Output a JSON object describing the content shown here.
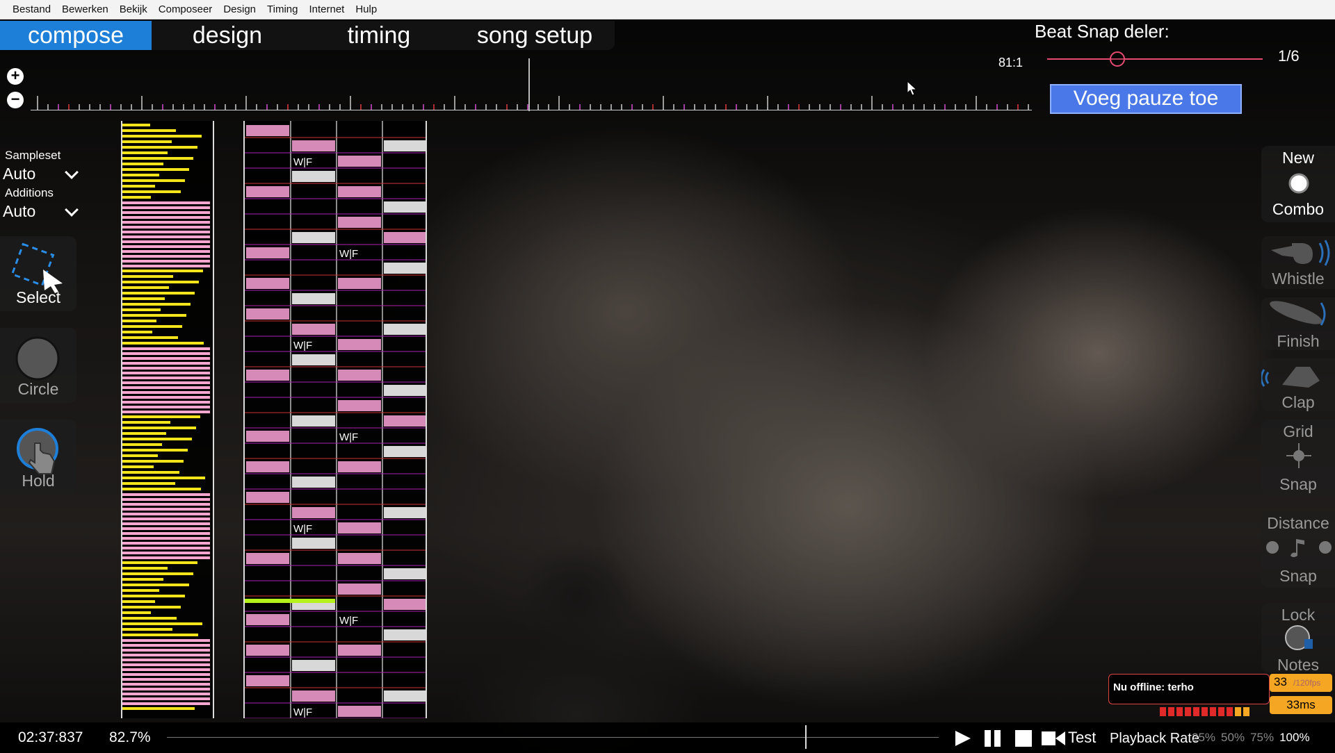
{
  "menu": [
    "Bestand",
    "Bewerken",
    "Bekijk",
    "Composeer",
    "Design",
    "Timing",
    "Internet",
    "Hulp"
  ],
  "tabs": [
    {
      "label": "compose",
      "active": true
    },
    {
      "label": "design",
      "active": false
    },
    {
      "label": "timing",
      "active": false
    },
    {
      "label": "song setup",
      "active": false
    }
  ],
  "beat_snap": {
    "title": "Beat Snap deler:",
    "position": "81:1",
    "value": "1/6"
  },
  "break_button": "Voeg pauze toe",
  "sampleset": {
    "label": "Sampleset",
    "value": "Auto"
  },
  "additions": {
    "label": "Additions",
    "value": "Auto"
  },
  "tools": {
    "select": "Select",
    "circle": "Circle",
    "hold": "Hold"
  },
  "toggles": {
    "new_combo_line1": "New",
    "new_combo_line2": "Combo",
    "whistle": "Whistle",
    "finish": "Finish",
    "clap": "Clap",
    "grid_line1": "Grid",
    "grid_line2": "Snap",
    "distance_line1": "Distance",
    "distance_line2": "Snap",
    "lock_line1": "Lock",
    "lock_line2": "Notes"
  },
  "mania_hitsound_label": "W|F",
  "notification": "Nu offline: terho",
  "fps": {
    "value": "33",
    "unit": "/120fps"
  },
  "frame_time": "33ms",
  "bottom": {
    "time": "02:37:837",
    "progress_percent": "82.7%",
    "test": "Test",
    "playback_rate_label": "Playback Rate",
    "playback_rates": [
      "25%",
      "50%",
      "75%",
      "100%"
    ],
    "selected_rate": "100%"
  },
  "colors": {
    "accent": "#1e7fd8",
    "snap_red": "#e84a72",
    "break_button": "#4a78e8",
    "strain_yellow": "#f3e51a",
    "strain_pink": "#f7a6cf",
    "note_pink": "#d68ab8",
    "note_white": "#d8d8d8",
    "green_bar": "#b5f11a"
  }
}
